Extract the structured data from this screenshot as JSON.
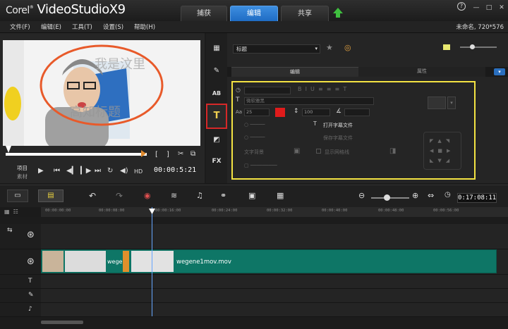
{
  "app": {
    "logo_corel": "Corel",
    "logo_name": "VideoStudioX9"
  },
  "workspace_tabs": [
    {
      "label": "捕获"
    },
    {
      "label": "编辑"
    },
    {
      "label": "共享"
    }
  ],
  "window_controls": {
    "help": "?",
    "minimize": "—",
    "maximize": "□",
    "close": "✕"
  },
  "menu": [
    {
      "label": "文件(F)"
    },
    {
      "label": "编辑(E)"
    },
    {
      "label": "工具(T)"
    },
    {
      "label": "设置(S)"
    },
    {
      "label": "帮助(H)"
    }
  ],
  "project_info": "未命名, 720*576",
  "player": {
    "mode_project": "项目",
    "mode_clip": "素材",
    "hd": "HD",
    "timecode": "00:00:5:21",
    "overlay_text_1": "我是汶里",
    "overlay_text_2": "高知标题"
  },
  "options": {
    "dropdown": "标题",
    "tab_edit": "编辑",
    "tab_attr": "属性",
    "font_dropdown": "微软雅黑",
    "font_size": "25",
    "line_spacing": "100",
    "open_subtitle": "打开字幕文件",
    "save_subtitle": "保存字幕文件",
    "text_background": "文字背景",
    "show_grid": "显示网格线",
    "accent_color": "#e01b1b"
  },
  "timeline": {
    "time": "0:17:08:11",
    "ruler": [
      "00:00:00:00",
      "00:00:08:00",
      "00:00:16:00",
      "00:00:24:00",
      "00:00:32:00",
      "00:00:40:00",
      "00:00:48:00",
      "00:00:56:00"
    ],
    "clip_label_1": "wege",
    "clip_label_2": "wegene1mov.mov"
  },
  "colors": {
    "highlight_box": "#f4e342",
    "active_tab": "#1f6cc4",
    "clip": "#0e7666",
    "selected_tool_border": "#d62828"
  }
}
